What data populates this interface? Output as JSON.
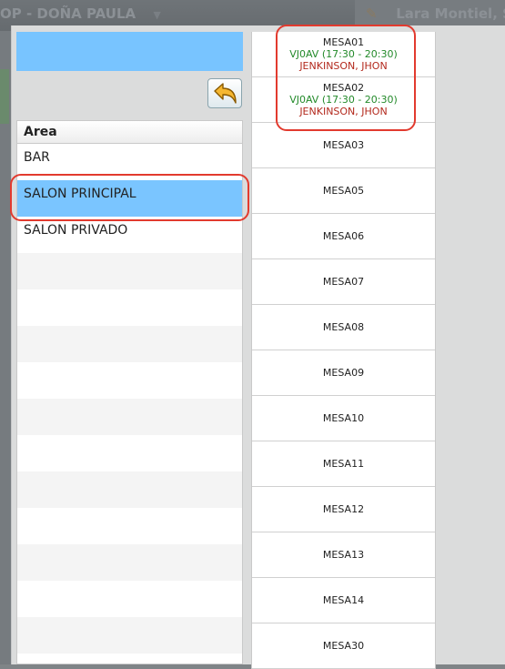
{
  "topbar": {
    "left_title": "OP - DOÑA PAULA",
    "right_user": "Lara Montiel, S"
  },
  "back_button": {
    "icon": "undo-arrow-icon"
  },
  "area_list": {
    "header": "Area",
    "items": [
      "BAR",
      "SALON PRINCIPAL",
      "SALON PRIVADO"
    ],
    "selected": "SALON PRINCIPAL"
  },
  "tables": [
    {
      "name": "MESA01",
      "reservation": "VJ0AV (17:30 - 20:30)",
      "guest": "JENKINSON, JHON"
    },
    {
      "name": "MESA02",
      "reservation": "VJ0AV (17:30 - 20:30)",
      "guest": "JENKINSON, JHON"
    },
    {
      "name": "MESA03"
    },
    {
      "name": "MESA05"
    },
    {
      "name": "MESA06"
    },
    {
      "name": "MESA07"
    },
    {
      "name": "MESA08"
    },
    {
      "name": "MESA09"
    },
    {
      "name": "MESA10"
    },
    {
      "name": "MESA11"
    },
    {
      "name": "MESA12"
    },
    {
      "name": "MESA13"
    },
    {
      "name": "MESA14"
    },
    {
      "name": "MESA30"
    }
  ],
  "colors": {
    "selection": "#7ac5ff",
    "reservation_text": "#238a2a",
    "guest_text": "#b3291d",
    "highlight": "#e23a2e"
  }
}
